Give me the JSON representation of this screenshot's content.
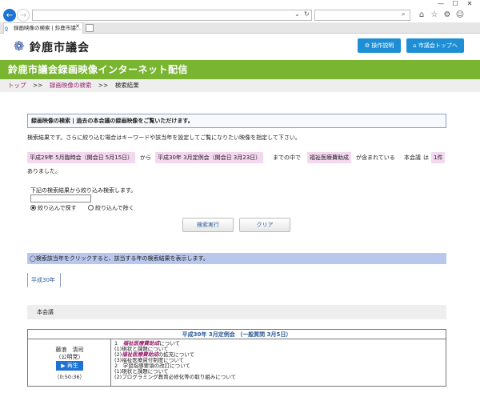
{
  "browser": {
    "window_controls": [
      "—",
      "☐",
      "✕"
    ],
    "tab_title": "録画映像の検索 | 鈴鹿市議...",
    "tab_close": "✕",
    "back_icon": "←",
    "forward_icon": "→",
    "url_icons": [
      "⌄",
      "↻"
    ],
    "search_icon": "⌕",
    "toolbar_icons": [
      "⌂",
      "☆",
      "⚙",
      "☺"
    ]
  },
  "header": {
    "site_name": "鈴鹿市議会",
    "guide_button": "操作説明",
    "top_button": "市議会トップへ"
  },
  "banner": {
    "title": "鈴鹿市議会録画映像インターネット配信"
  },
  "breadcrumb": {
    "items": [
      "トップ",
      "録画映像の検索",
      "検索結果"
    ],
    "separator": ">>"
  },
  "section": {
    "heading": "録画映像の検索 | 過去の本会議の録画映像をご覧いただけます。",
    "description": "検索結果です。さらに絞り込む場合はキーワードや該当年を設定してご覧になりたい映像を指定して下さい。"
  },
  "criteria": {
    "from_session": "平成29年 5月臨時会（開会日 5月15日）",
    "from_label": "から",
    "to_session": "平成30年 3月定例会（開会日 3月23日）",
    "range_label": "までの中で",
    "keyword": "福祉医療費助成",
    "contains_label": "が含まれている",
    "meeting_label": "本会議",
    "is_label": "は",
    "count": "1件",
    "suffix": "ありました。"
  },
  "refine": {
    "label": "下記の検索結果から絞り込み検索します。",
    "input_value": "",
    "option_include": "絞り込んで探す",
    "option_exclude": "絞り込んで除く",
    "search_button": "検索実行",
    "clear_button": "クリア"
  },
  "info_bar": "◯検索該当年をクリックすると、該当する年の検索結果を表示します。",
  "year_tab": "平成30年",
  "session_title": "本会議",
  "result": {
    "heading": "平成30年 3月定例会 （一般質問 3月5日）",
    "speaker_name": "藤浪　清司",
    "speaker_party": "（公明党）",
    "play_label": "▶ 再生",
    "duration": "（0:50:36）",
    "topics": [
      {
        "pre": "1　",
        "kw": "福祉医療費助成",
        "post": "について"
      },
      {
        "pre": "(1)現状と課題について",
        "kw": "",
        "post": ""
      },
      {
        "pre": "(2)",
        "kw": "福祉医療費助成",
        "post": "の拡充について"
      },
      {
        "pre": "(3)福祉医療貸付制度について",
        "kw": "",
        "post": ""
      },
      {
        "pre": "2　学習指導要領の改訂について",
        "kw": "",
        "post": ""
      },
      {
        "pre": "(1)現状と課題について",
        "kw": "",
        "post": ""
      },
      {
        "pre": "(2)プログラミング教育必修化等の取り組みについて",
        "kw": "",
        "post": ""
      }
    ]
  },
  "colors": {
    "banner": "#79b531",
    "header_button": "#1e8fd4",
    "highlight": "#f3d8ef",
    "info_bar": "#b9c7ec",
    "link": "#9b2470"
  }
}
